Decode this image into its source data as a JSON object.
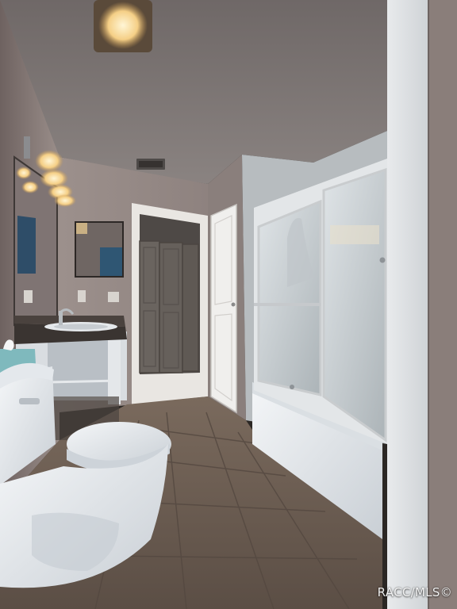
{
  "photo": {
    "watermark": "RACC/MLS©",
    "scene_objects": [
      "ceiling-light",
      "vanity-light",
      "vanity-mirror",
      "vanity-sink",
      "tissue-box",
      "toilet",
      "closet-bifold-door",
      "interior-door",
      "sliding-glass-shower-door",
      "bathtub",
      "ceiling-vent",
      "tile-floor"
    ],
    "colors": {
      "wall": "#8f8380",
      "ceiling": "#7e7775",
      "floor": "#6a5c52",
      "fixtures": "#e9ecef",
      "countertop": "#3a3431",
      "closet": "#5f5a55"
    }
  }
}
